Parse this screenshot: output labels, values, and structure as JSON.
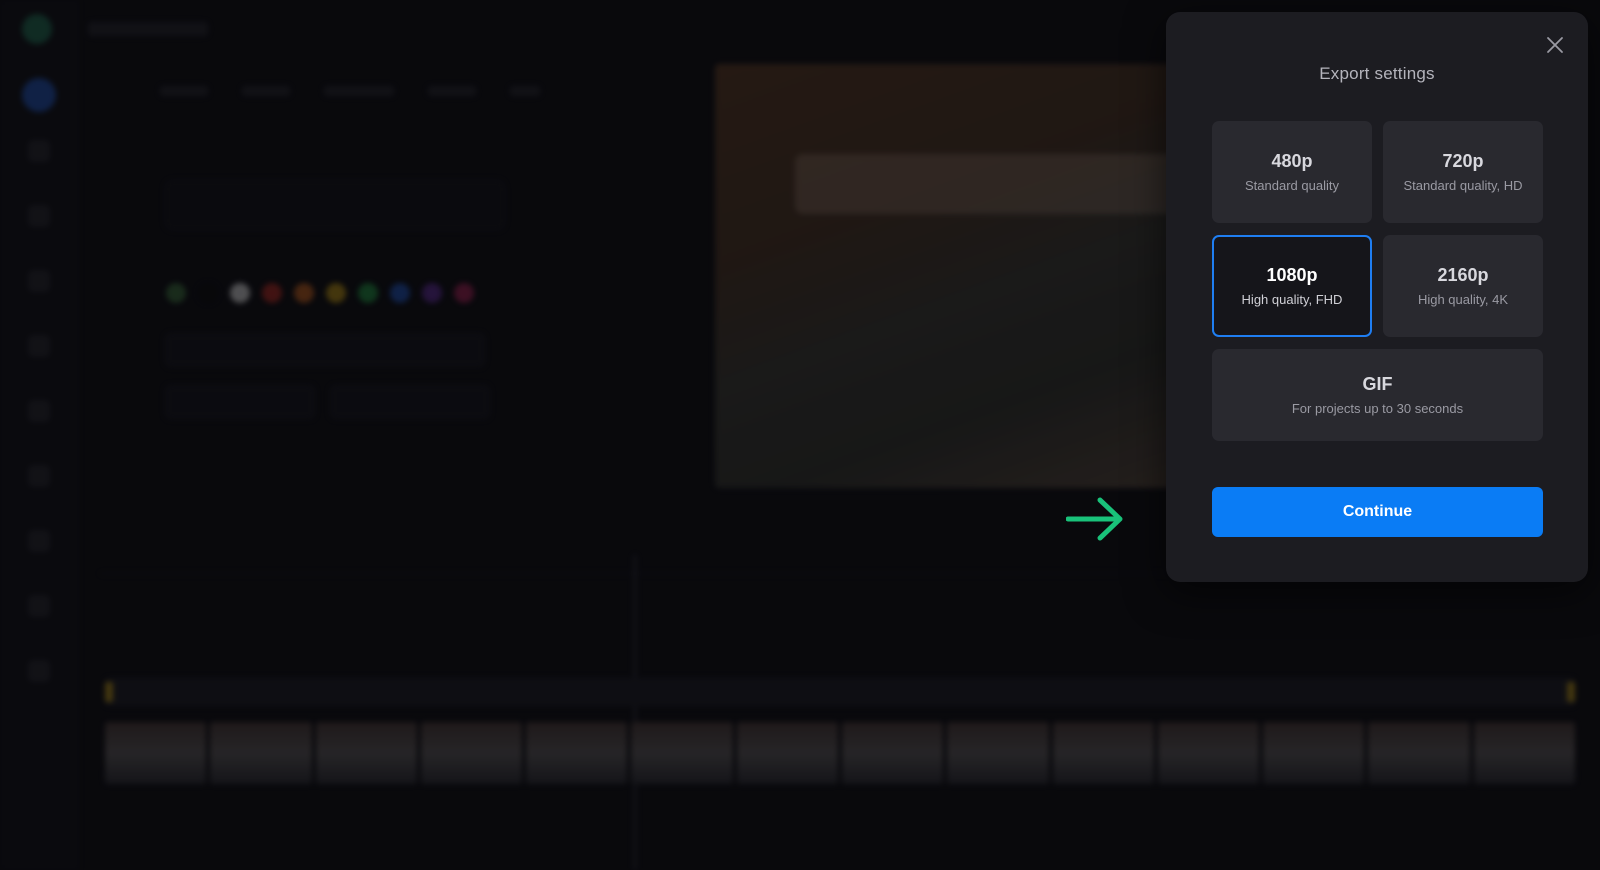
{
  "dialog": {
    "title": "Export settings",
    "options": [
      {
        "resolution": "480p",
        "description": "Standard quality",
        "selected": false
      },
      {
        "resolution": "720p",
        "description": "Standard quality, HD",
        "selected": false
      },
      {
        "resolution": "1080p",
        "description": "High quality, FHD",
        "selected": true
      },
      {
        "resolution": "2160p",
        "description": "High quality, 4K",
        "selected": false
      }
    ],
    "gif": {
      "label": "GIF",
      "description": "For projects up to 30 seconds"
    },
    "continue_label": "Continue"
  },
  "colors": {
    "accent": "#0a7cf5",
    "selected_border": "#1f7ef2",
    "pointer_arrow": "#19c27a",
    "dialog_bg": "#1c1c21"
  },
  "icons": {
    "close": "close-icon",
    "pointer": "arrow-right-icon"
  }
}
